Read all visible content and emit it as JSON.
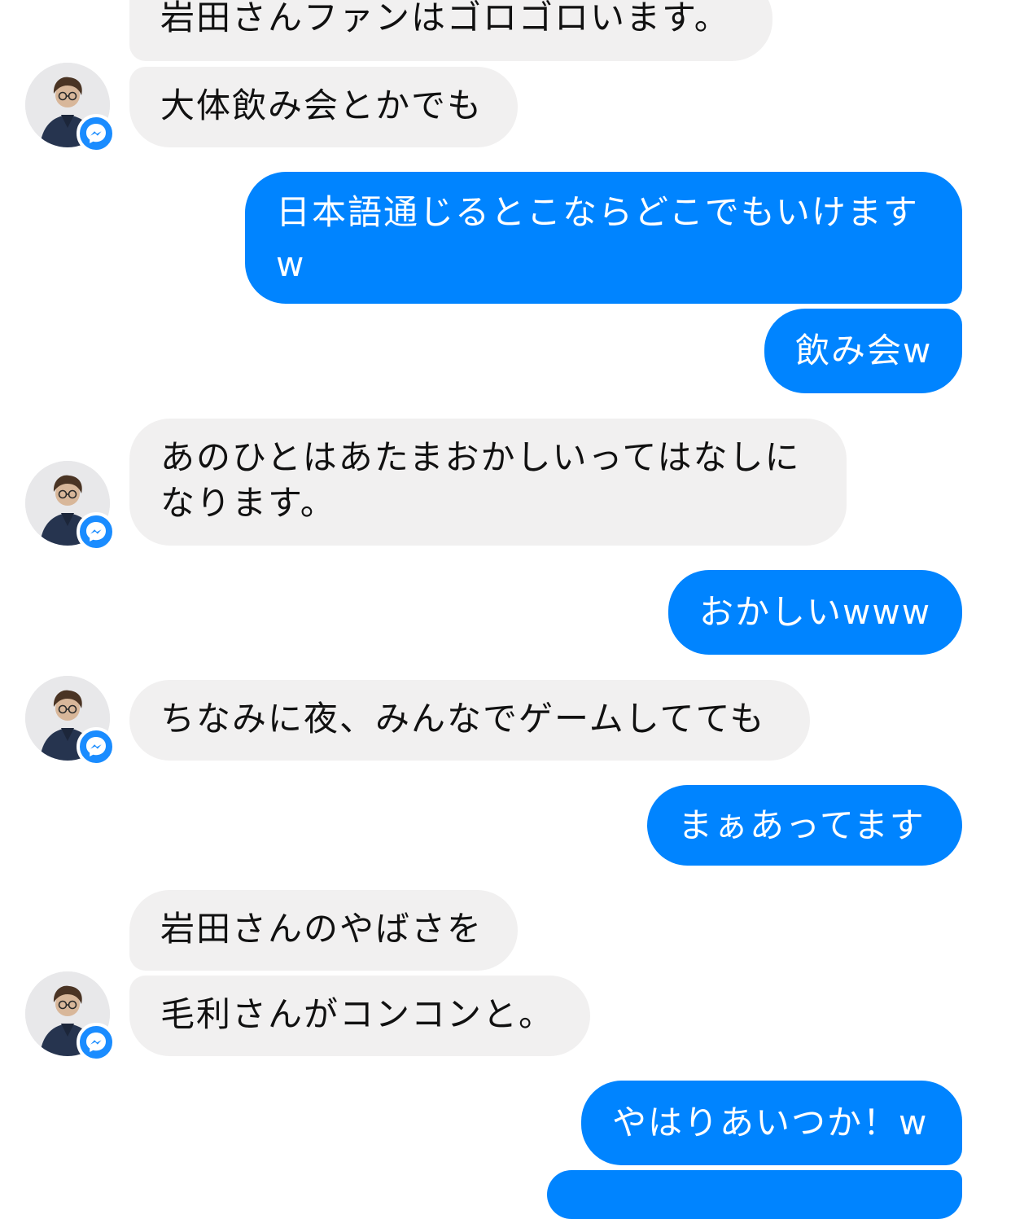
{
  "chat": {
    "accent_color": "#0084ff",
    "incoming_color": "#f1f0f0",
    "messages": [
      {
        "from": "them",
        "text": "岩田さんファンはゴロゴロいます。"
      },
      {
        "from": "them",
        "text": "大体飲み会とかでも"
      },
      {
        "from": "me",
        "line1": "日本語通じるとこならどこでもいけます",
        "line2": "w"
      },
      {
        "from": "me",
        "text": "飲み会w"
      },
      {
        "from": "them",
        "line1": "あのひとはあたまおかしいってはなしに",
        "line2": "なります。"
      },
      {
        "from": "me",
        "text": "おかしいwww"
      },
      {
        "from": "them",
        "text": "ちなみに夜、みんなでゲームしてても"
      },
      {
        "from": "me",
        "text": "まぁあってます"
      },
      {
        "from": "them",
        "text": "岩田さんのやばさを"
      },
      {
        "from": "them",
        "text": "毛利さんがコンコンと。"
      },
      {
        "from": "me",
        "text": "やはりあいつか！w"
      }
    ],
    "avatar_icon": "user-photo-avatar",
    "badge_icon": "messenger-badge-icon"
  }
}
